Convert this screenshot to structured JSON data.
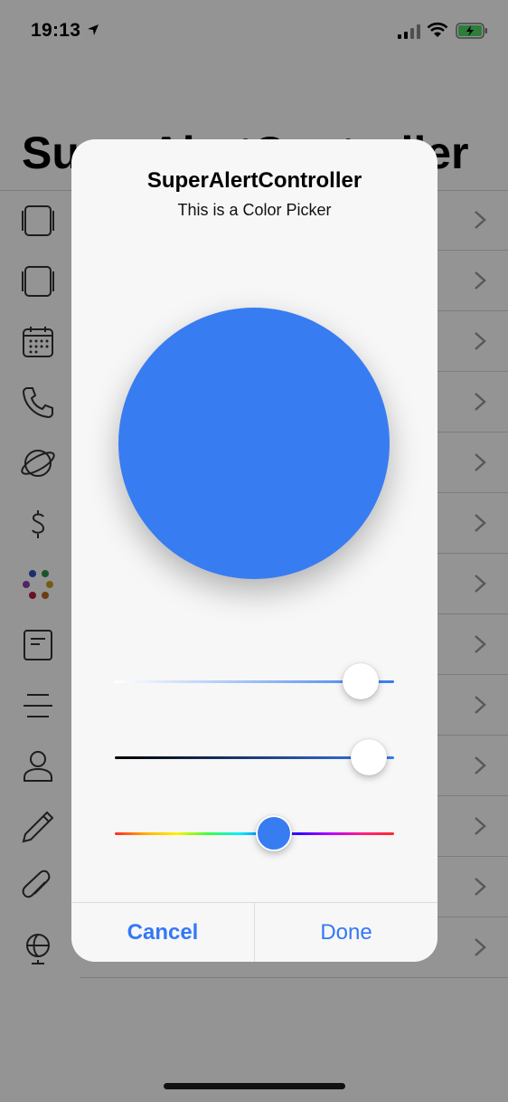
{
  "status_bar": {
    "time": "19:13"
  },
  "background_app": {
    "title": "SuperAlertController",
    "rows": [
      {
        "icon": "cards-icon"
      },
      {
        "icon": "cards-icon"
      },
      {
        "icon": "calendar-icon"
      },
      {
        "icon": "phone-icon"
      },
      {
        "icon": "planet-icon"
      },
      {
        "icon": "dollar-icon"
      },
      {
        "icon": "color-dots-icon"
      },
      {
        "icon": "document-icon"
      },
      {
        "icon": "lines-icon"
      },
      {
        "icon": "person-icon"
      },
      {
        "icon": "pencil-icon"
      },
      {
        "icon": "paperclip-icon"
      },
      {
        "icon": "globe-icon"
      }
    ]
  },
  "alert": {
    "title": "SuperAlertController",
    "subtitle": "This is a Color Picker",
    "selected_color": "#387cf1",
    "sliders": [
      {
        "name": "saturation",
        "value": 0.88
      },
      {
        "name": "brightness",
        "value": 0.91
      },
      {
        "name": "hue",
        "value": 0.57
      }
    ],
    "cancel_label": "Cancel",
    "done_label": "Done"
  },
  "colors": {
    "accent": "#3478f6"
  }
}
